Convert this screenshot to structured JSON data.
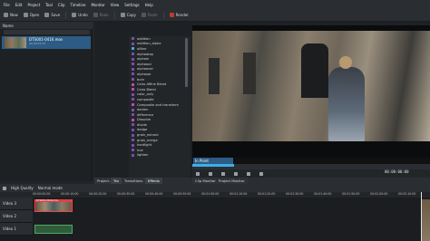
{
  "menubar": [
    "File",
    "Edit",
    "Project",
    "Tool",
    "Clip",
    "Timeline",
    "Monitor",
    "View",
    "Settings",
    "Help"
  ],
  "toolbar": {
    "new": "New",
    "open": "Open",
    "save": "Save",
    "undo": "Undo",
    "redo": "Redo",
    "copy": "Copy",
    "paste": "Paste",
    "render": "Render"
  },
  "bin": {
    "header": "Name",
    "clip_name": "DTS001-0416.mov",
    "clip_duration": "00:00:03:13"
  },
  "effects": [
    {
      "label": "addition",
      "color": "#7b4fb0"
    },
    {
      "label": "addition_alpha",
      "color": "#7b4fb0"
    },
    {
      "label": "aNine",
      "color": "#3daee9"
    },
    {
      "label": "alphaatop",
      "color": "#7b4fb0"
    },
    {
      "label": "alphain",
      "color": "#7b4fb0"
    },
    {
      "label": "alphaout",
      "color": "#7b4fb0"
    },
    {
      "label": "alphaover",
      "color": "#7b4fb0"
    },
    {
      "label": "alphaxor",
      "color": "#7b4fb0"
    },
    {
      "label": "burn",
      "color": "#7b4fb0"
    },
    {
      "label": "Cairo Affine Blend",
      "color": "#c14db0"
    },
    {
      "label": "Cairo Blend",
      "color": "#c14db0"
    },
    {
      "label": "color_only",
      "color": "#7b4fb0"
    },
    {
      "label": "composite",
      "color": "#7b4fb0"
    },
    {
      "label": "Composite and transform",
      "color": "#c14db0"
    },
    {
      "label": "darken",
      "color": "#7b4fb0"
    },
    {
      "label": "difference",
      "color": "#7b4fb0"
    },
    {
      "label": "Dissolve",
      "color": "#c14db0"
    },
    {
      "label": "divide",
      "color": "#7b4fb0"
    },
    {
      "label": "dodge",
      "color": "#7b4fb0"
    },
    {
      "label": "grain_extract",
      "color": "#7b4fb0"
    },
    {
      "label": "grain_merge",
      "color": "#7b4fb0"
    },
    {
      "label": "hardlight",
      "color": "#7b4fb0"
    },
    {
      "label": "hue",
      "color": "#7b4fb0"
    },
    {
      "label": "lighten",
      "color": "#7b4fb0"
    }
  ],
  "monitor": {
    "in_point": "In Point",
    "timecode": "00:00:00:00"
  },
  "tabs": [
    {
      "label": "Project...",
      "active": false
    },
    {
      "label": "Tra",
      "active": true
    },
    {
      "label": "Transitions",
      "active": false
    },
    {
      "label": "Effects",
      "active": true
    },
    {
      "label": "Clip Monitor",
      "active": false
    },
    {
      "label": "Project Monitor",
      "active": false
    }
  ],
  "timeline": {
    "quality": "High Quality",
    "mode": "Normal mode",
    "ticks": [
      "00:00:00:00",
      "00:00:10:00",
      "00:00:20:00",
      "00:00:30:00",
      "00:00:40:00",
      "00:00:50:00",
      "00:01:00:00",
      "00:01:10:00",
      "00:01:20:00",
      "00:01:30:00",
      "00:01:40:00",
      "00:01:50:00",
      "00:02:00:00",
      "00:02:10:00"
    ],
    "tracks": [
      "Video 3",
      "Video 2",
      "Video 1"
    ],
    "clip_title": "DTS001-0416.mov"
  }
}
